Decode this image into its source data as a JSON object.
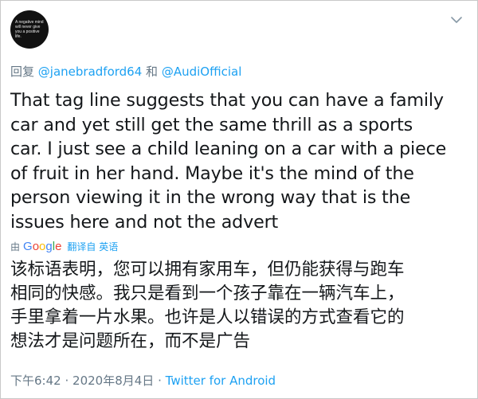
{
  "avatar": {
    "text": "A negative mind will never give you a positive life."
  },
  "reply": {
    "prefix": "回复",
    "user1": "@janebradford64",
    "conjunction": "和",
    "user2": "@AudiOfficial"
  },
  "tweet": {
    "lines": [
      "That tag line suggests that you can have a family",
      "car and yet still get the same thrill as a sports",
      "car. I just see a child leaning on a car with a piece",
      "of fruit in her hand. Maybe it's the mind of the",
      "person viewing it in the wrong way that is the",
      "issues here and not the advert"
    ]
  },
  "translation": {
    "by": "由",
    "provider": "Google",
    "action_label": "翻译自 英语",
    "lines": [
      "该标语表明，您可以拥有家用车，但仍能获得与跑车",
      "相同的快感。我只是看到一个孩子靠在一辆汽车上，",
      "手里拿着一片水果。也许是人以错误的方式查看它的",
      "想法才是问题所在，而不是广告"
    ]
  },
  "meta": {
    "time": "下午6:42",
    "separator": "·",
    "date": "2020年8月4日",
    "source": "Twitter for Android"
  },
  "icons": {
    "menu": "chevron-down-icon"
  },
  "colors": {
    "link": "#1da1f2",
    "muted": "#657786",
    "text": "#14171a"
  }
}
